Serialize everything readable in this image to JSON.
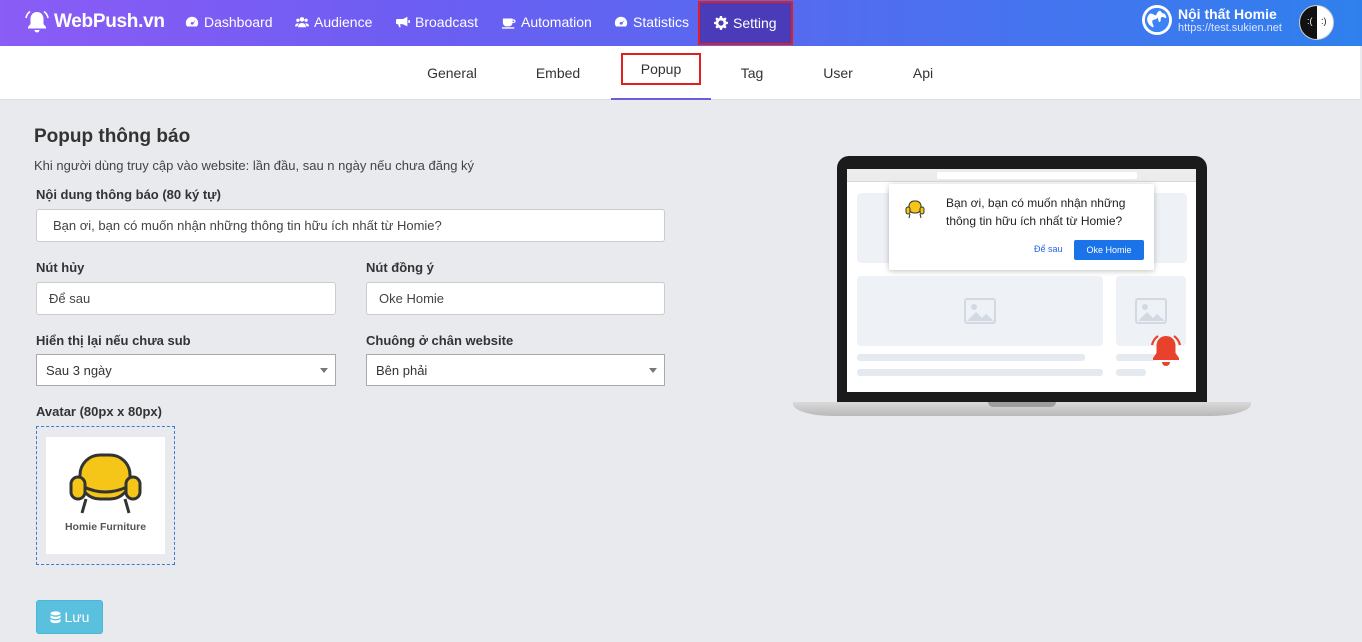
{
  "brand": {
    "name": "WebPush.vn"
  },
  "nav": {
    "items": [
      {
        "label": "Dashboard",
        "icon": "tachometer-icon"
      },
      {
        "label": "Audience",
        "icon": "users-icon"
      },
      {
        "label": "Broadcast",
        "icon": "bullhorn-icon"
      },
      {
        "label": "Automation",
        "icon": "coffee-icon"
      },
      {
        "label": "Statistics",
        "icon": "tachometer-icon"
      },
      {
        "label": "Setting",
        "icon": "gear-icon",
        "active": true
      }
    ]
  },
  "profile": {
    "name": "Nội thất Homie",
    "url": "https://test.sukien.net",
    "avatar_left": ":(",
    "avatar_right": ":)"
  },
  "tabs": [
    {
      "label": "General"
    },
    {
      "label": "Embed"
    },
    {
      "label": "Popup",
      "active": true
    },
    {
      "label": "Tag"
    },
    {
      "label": "User"
    },
    {
      "label": "Api"
    }
  ],
  "form": {
    "title": "Popup thông báo",
    "description": "Khi người dùng truy cập vào website: lần đầu, sau n ngày nếu chưa đăng ký",
    "message_label": "Nội dung thông báo (80 ký tự)",
    "message_value": "Bạn ơi, bạn có muốn nhận những thông tin hữu ích nhất từ Homie?",
    "cancel_label": "Nút hủy",
    "cancel_value": "Để sau",
    "accept_label": "Nút đồng ý",
    "accept_value": "Oke Homie",
    "redisplay_label": "Hiển thị lại nếu chưa sub",
    "redisplay_value": "Sau 3 ngày",
    "bell_label": "Chuông ở chân website",
    "bell_value": "Bên phải",
    "avatar_label": "Avatar (80px x 80px)",
    "avatar_logo_text": "Homie Furniture",
    "save_label": "Lưu"
  },
  "preview": {
    "message": "Bạn ơi, bạn có muốn nhận những thông tin hữu ích nhất từ Homie?",
    "later": "Để sau",
    "ok": "Oke Homie"
  },
  "colors": {
    "accent": "#6b5cd8",
    "highlight": "#e02020",
    "save": "#5bc0de",
    "logo_yellow": "#f5c518"
  }
}
